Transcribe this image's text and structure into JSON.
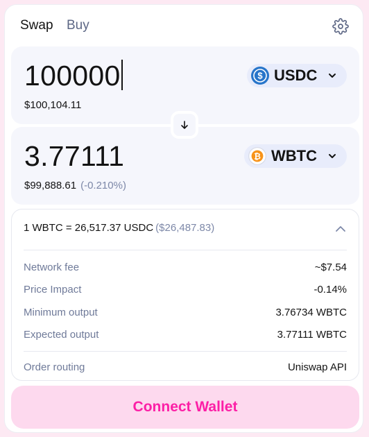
{
  "tabs": {
    "swap": "Swap",
    "buy": "Buy"
  },
  "icons": {
    "settings": "gear-icon",
    "swap_direction": "arrow-down-icon",
    "token_dropdown": "chevron-down-icon",
    "details_toggle": "chevron-up-icon"
  },
  "input": {
    "amount": "100000",
    "usd_value": "$100,104.11",
    "token": {
      "symbol": "USDC",
      "icon": "usdc-icon",
      "color": "#2775ca"
    }
  },
  "output": {
    "amount": "3.77111",
    "usd_value": "$99,888.61",
    "price_change": "(-0.210%)",
    "token": {
      "symbol": "WBTC",
      "icon": "wbtc-icon",
      "color": "#f7931a"
    }
  },
  "details": {
    "rate": "1 WBTC = 26,517.37 USDC",
    "rate_usd": "($26,487.83)",
    "rows": [
      {
        "label": "Network fee",
        "value": "~$7.54"
      },
      {
        "label": "Price Impact",
        "value": "-0.14%"
      },
      {
        "label": "Minimum output",
        "value": "3.76734 WBTC"
      },
      {
        "label": "Expected output",
        "value": "3.77111 WBTC"
      }
    ],
    "routing": {
      "label": "Order routing",
      "value": "Uniswap API"
    }
  },
  "connect_button": "Connect Wallet",
  "colors": {
    "accent": "#fc1fa6",
    "accent_soft": "#fdd9ee",
    "panel_bg": "#f5f6fc",
    "token_pill_bg": "#e8ecfb",
    "secondary_text": "#7d88a8"
  }
}
